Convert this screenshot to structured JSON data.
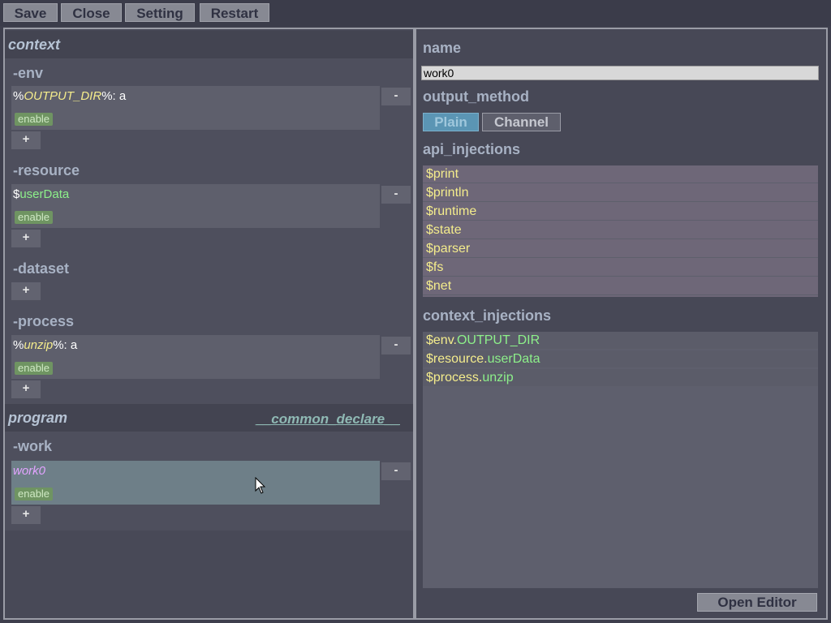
{
  "toolbar": {
    "save": "Save",
    "close": "Close",
    "setting": "Setting",
    "restart": "Restart"
  },
  "left": {
    "context_title": "context",
    "env": {
      "title": "-env",
      "item": {
        "prefix": "%",
        "key": "OUTPUT_DIR",
        "suffix": "%: a",
        "badge": "enable"
      }
    },
    "resource": {
      "title": "-resource",
      "item": {
        "prefix": "$",
        "key": "userData",
        "badge": "enable"
      }
    },
    "dataset": {
      "title": "-dataset"
    },
    "process": {
      "title": "-process",
      "item": {
        "prefix": "%",
        "key": "unzip",
        "suffix": "%: a",
        "badge": "enable"
      }
    },
    "program_title": "program",
    "common_declare": "__common_declare__",
    "work": {
      "title": "-work",
      "item": {
        "key": "work0",
        "badge": "enable"
      }
    },
    "add_label": "+",
    "remove_label": "-"
  },
  "right": {
    "name_label": "name",
    "name_value": "work0",
    "output_method_label": "output_method",
    "output_options": [
      "Plain",
      "Channel"
    ],
    "output_selected": "Plain",
    "api_label": "api_injections",
    "api_items": [
      "$print",
      "$println",
      "$runtime",
      "$state",
      "$parser",
      "$fs",
      "$net"
    ],
    "context_label": "context_injections",
    "context_items": [
      {
        "prefix": "$env.",
        "key": "OUTPUT_DIR"
      },
      {
        "prefix": "$resource.",
        "key": "userData"
      },
      {
        "prefix": "$process.",
        "key": "unzip"
      }
    ],
    "open_editor": "Open Editor"
  },
  "colors": {
    "background": "#3e3f4d",
    "panel": "#484957",
    "selected_item": "#6e7f88",
    "keyword_yellow": "#f4ec8c",
    "keyword_green": "#8df08a",
    "keyword_pink": "#e2a3ff",
    "badge_green": "#6f9462"
  }
}
